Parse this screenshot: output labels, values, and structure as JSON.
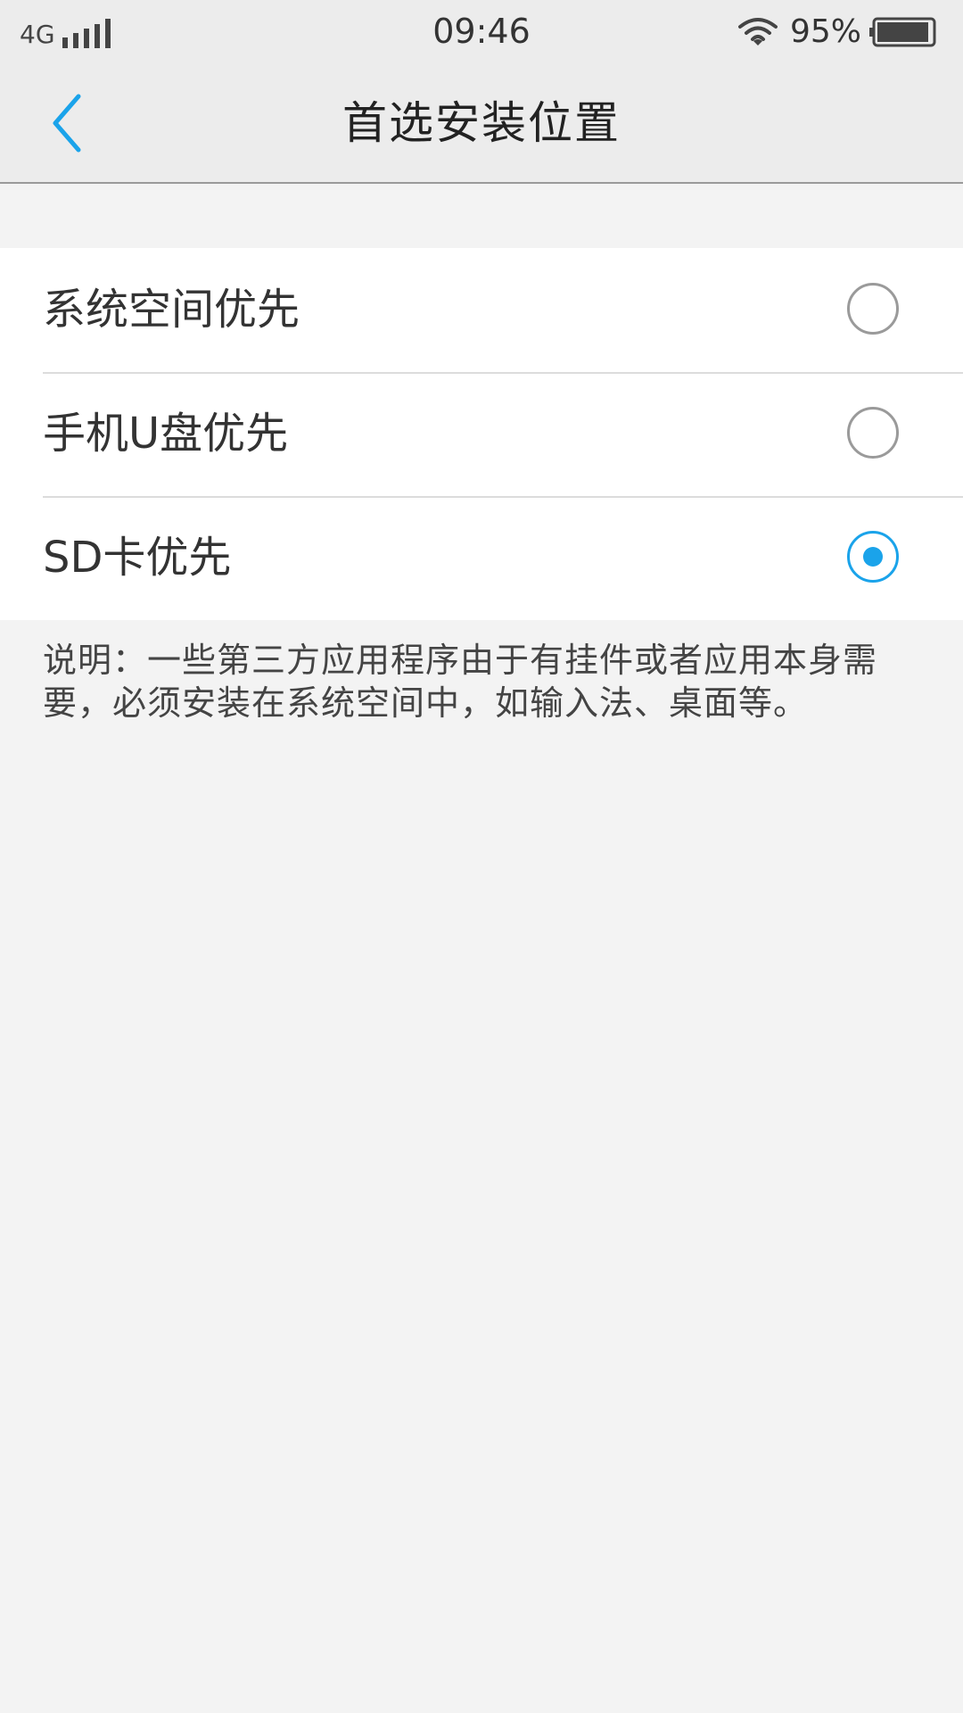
{
  "status_bar": {
    "network": "4G",
    "signal_bars": 5,
    "time": "09:46",
    "battery_percent_text": "95%",
    "battery_level": 0.95,
    "icons": [
      "signal-icon",
      "wifi-icon",
      "battery-icon"
    ]
  },
  "header": {
    "title": "首选安装位置",
    "back_icon": "chevron-left-icon"
  },
  "options": [
    {
      "label": "系统空间优先",
      "selected": false
    },
    {
      "label": "手机U盘优先",
      "selected": false
    },
    {
      "label": "SD卡优先",
      "selected": true
    }
  ],
  "note": "说明：一些第三方应用程序由于有挂件或者应用本身需要，必须安装在系统空间中，如输入法、桌面等。",
  "colors": {
    "accent": "#1aa3ea",
    "background": "#f3f3f3",
    "header_background": "#ececec",
    "list_background": "#ffffff"
  }
}
